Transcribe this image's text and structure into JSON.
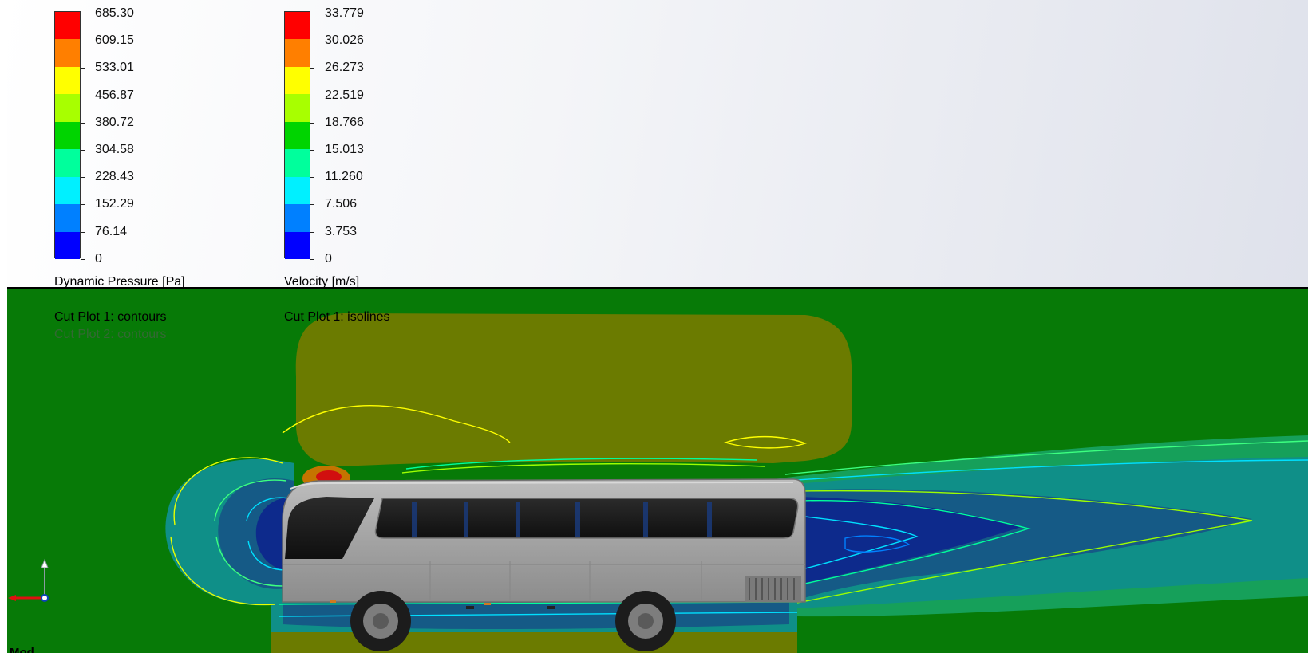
{
  "viewport": {
    "colors": {
      "background_top": "#ffffff",
      "background_right": "#dde0ea",
      "field_green": "#077a07",
      "divider": "#000000"
    }
  },
  "legends": [
    {
      "id": "dynamic-pressure",
      "title": "Dynamic Pressure [Pa]",
      "ticks": [
        "685.30",
        "609.15",
        "533.01",
        "456.87",
        "380.72",
        "304.58",
        "228.43",
        "152.29",
        "76.14",
        "0"
      ],
      "colors": [
        "#ff0000",
        "#ff7f00",
        "#ffff00",
        "#a8ff00",
        "#00d400",
        "#00ff9c",
        "#00f0ff",
        "#0080ff",
        "#0000ff"
      ],
      "plot_label": "Cut Plot 1: contours",
      "plot_label_secondary": "Cut Plot 2: contours"
    },
    {
      "id": "velocity",
      "title": "Velocity [m/s]",
      "ticks": [
        "33.779",
        "30.026",
        "26.273",
        "22.519",
        "18.766",
        "15.013",
        "11.260",
        "7.506",
        "3.753",
        "0"
      ],
      "colors": [
        "#ff0000",
        "#ff7f00",
        "#ffff00",
        "#a8ff00",
        "#00d400",
        "#00ff9c",
        "#00f0ff",
        "#0080ff",
        "#0000ff"
      ],
      "plot_label": "Cut Plot 1: isolines"
    }
  ],
  "triad": {
    "icon": "coordinate-triad-icon",
    "x_color": "#e01010",
    "y_color": "#8a9aa0"
  },
  "view_label": "Mod..."
}
